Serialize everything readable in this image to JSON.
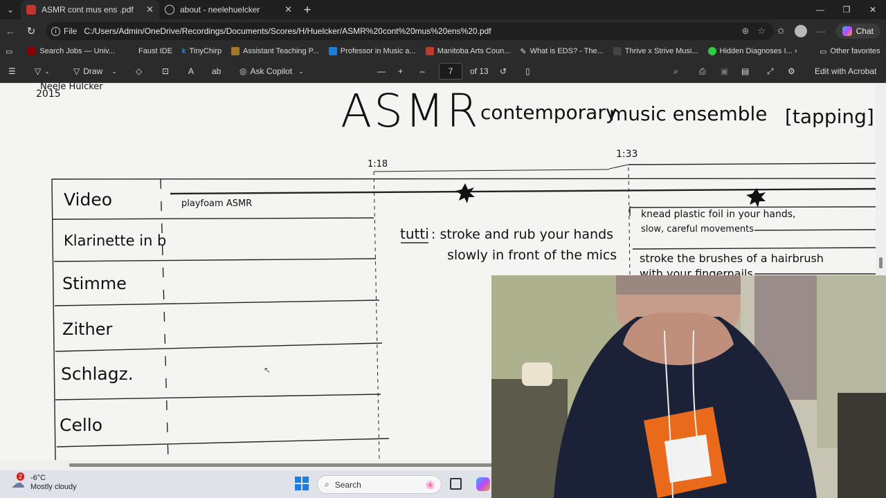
{
  "browser": {
    "tabs": [
      {
        "label": "ASMR cont mus ens .pdf",
        "active": true
      },
      {
        "label": "about - neelehuelcker",
        "active": false
      }
    ],
    "address": {
      "scheme_label": "File",
      "url": "C:/Users/Admin/OneDrive/Recordings/Documents/Scores/H/Huelcker/ASMR%20cont%20mus%20ens%20.pdf"
    },
    "chat_label": "Chat",
    "favorites": [
      "Search Jobs — Univ...",
      "Faust IDE",
      "TinyChirp",
      "Assistant Teaching P...",
      "Professor in Music a...",
      "Manitoba Arts Coun...",
      "What is EDS? - The...",
      "Thrive x Strive Musi...",
      "Hidden Diagnoses I..."
    ],
    "other_favorites": "Other favorites"
  },
  "pdf_toolbar": {
    "draw": "Draw",
    "ask_copilot": "Ask Copilot",
    "page_current": "7",
    "page_total": "of 13",
    "edit_acrobat": "Edit with Acrobat"
  },
  "score": {
    "author": "Neele Hülcker",
    "year": "2015",
    "title": "ASMR",
    "subtitle_a": "contemporary",
    "subtitle_b": "music ensemble",
    "bracket": "[tapping][scr",
    "markers": [
      "1:18",
      "1:33"
    ],
    "instruments": [
      "Video",
      "Klarinette in b",
      "Stimme",
      "Zither",
      "Schlagz.",
      "Cello"
    ],
    "video_note": "playfoam ASMR",
    "tutti_label": "tutti",
    "tutti_line1": ": stroke and rub your hands",
    "tutti_line2": "slowly in front of the mics",
    "knead_line1": "knead plastic foil in your hands,",
    "knead_line2": "slow, careful movements",
    "stroke_line1": "stroke the brushes of a hairbrush",
    "stroke_line2": "with your fingernails"
  },
  "taskbar": {
    "weather_temp": "-6°C",
    "weather_desc": "Mostly cloudy",
    "weather_badge": "2",
    "search_placeholder": "Search"
  }
}
